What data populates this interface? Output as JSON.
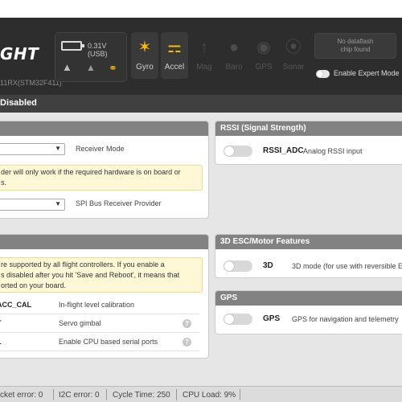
{
  "header": {
    "logo_text": "GHT",
    "board_info": "11RX(STM32F411)",
    "battery_voltage": "0.31V (USB)",
    "sensors": [
      {
        "label": "Gyro",
        "icon": "gyro-icon",
        "active": true
      },
      {
        "label": "Accel",
        "icon": "accel-icon",
        "active": true
      },
      {
        "label": "Mag",
        "icon": "mag-icon",
        "active": false
      },
      {
        "label": "Baro",
        "icon": "baro-icon",
        "active": false
      },
      {
        "label": "GPS",
        "icon": "gps-icon",
        "active": false
      },
      {
        "label": "Sonar",
        "icon": "sonar-icon",
        "active": false
      }
    ],
    "dataflash_line1": "No dataflash",
    "dataflash_line2": "chip found",
    "expert_mode_label": "Enable Expert Mode",
    "status_strip": "Disabled"
  },
  "receiver_panel": {
    "receiver_mode_label": "Receiver Mode",
    "warning_line1": "der will only work if the required hardware is on board or",
    "warning_line2": "s.",
    "spi_provider_label": "SPI Bus Receiver Provider"
  },
  "features_panel": {
    "note_line1": "re supported by all flight controllers. If you enable a",
    "note_line2": "s disabled after you hit 'Save and Reboot', it means that",
    "note_line3": "orted on your board.",
    "rows": [
      {
        "name": "ACC_CAL",
        "description": "In-flight level calibration",
        "help": false
      },
      {
        "name": "T",
        "description": "Servo gimbal",
        "help": true
      },
      {
        "name": "L",
        "description": "Enable CPU based serial ports",
        "help": true
      }
    ]
  },
  "rssi_panel": {
    "title": "RSSI (Signal Strength)",
    "option_name": "RSSI_ADC",
    "option_desc": "Analog RSSI input"
  },
  "esc_panel": {
    "title": "3D ESC/Motor Features",
    "option_name": "3D",
    "option_desc": "3D mode (for use with reversible ES"
  },
  "gps_panel": {
    "title": "GPS",
    "option_name": "GPS",
    "option_desc": "GPS for navigation and telemetry"
  },
  "footer": {
    "packet_error": "cket error: 0",
    "i2c_error": "I2C error: 0",
    "cycle_time": "Cycle Time: 250",
    "cpu_load": "CPU Load: 9%"
  },
  "colors": {
    "accent": "#ffbb00",
    "header_bg": "#2d2d2d",
    "panel_header": "#828282",
    "note_bg": "#fff8d6"
  }
}
